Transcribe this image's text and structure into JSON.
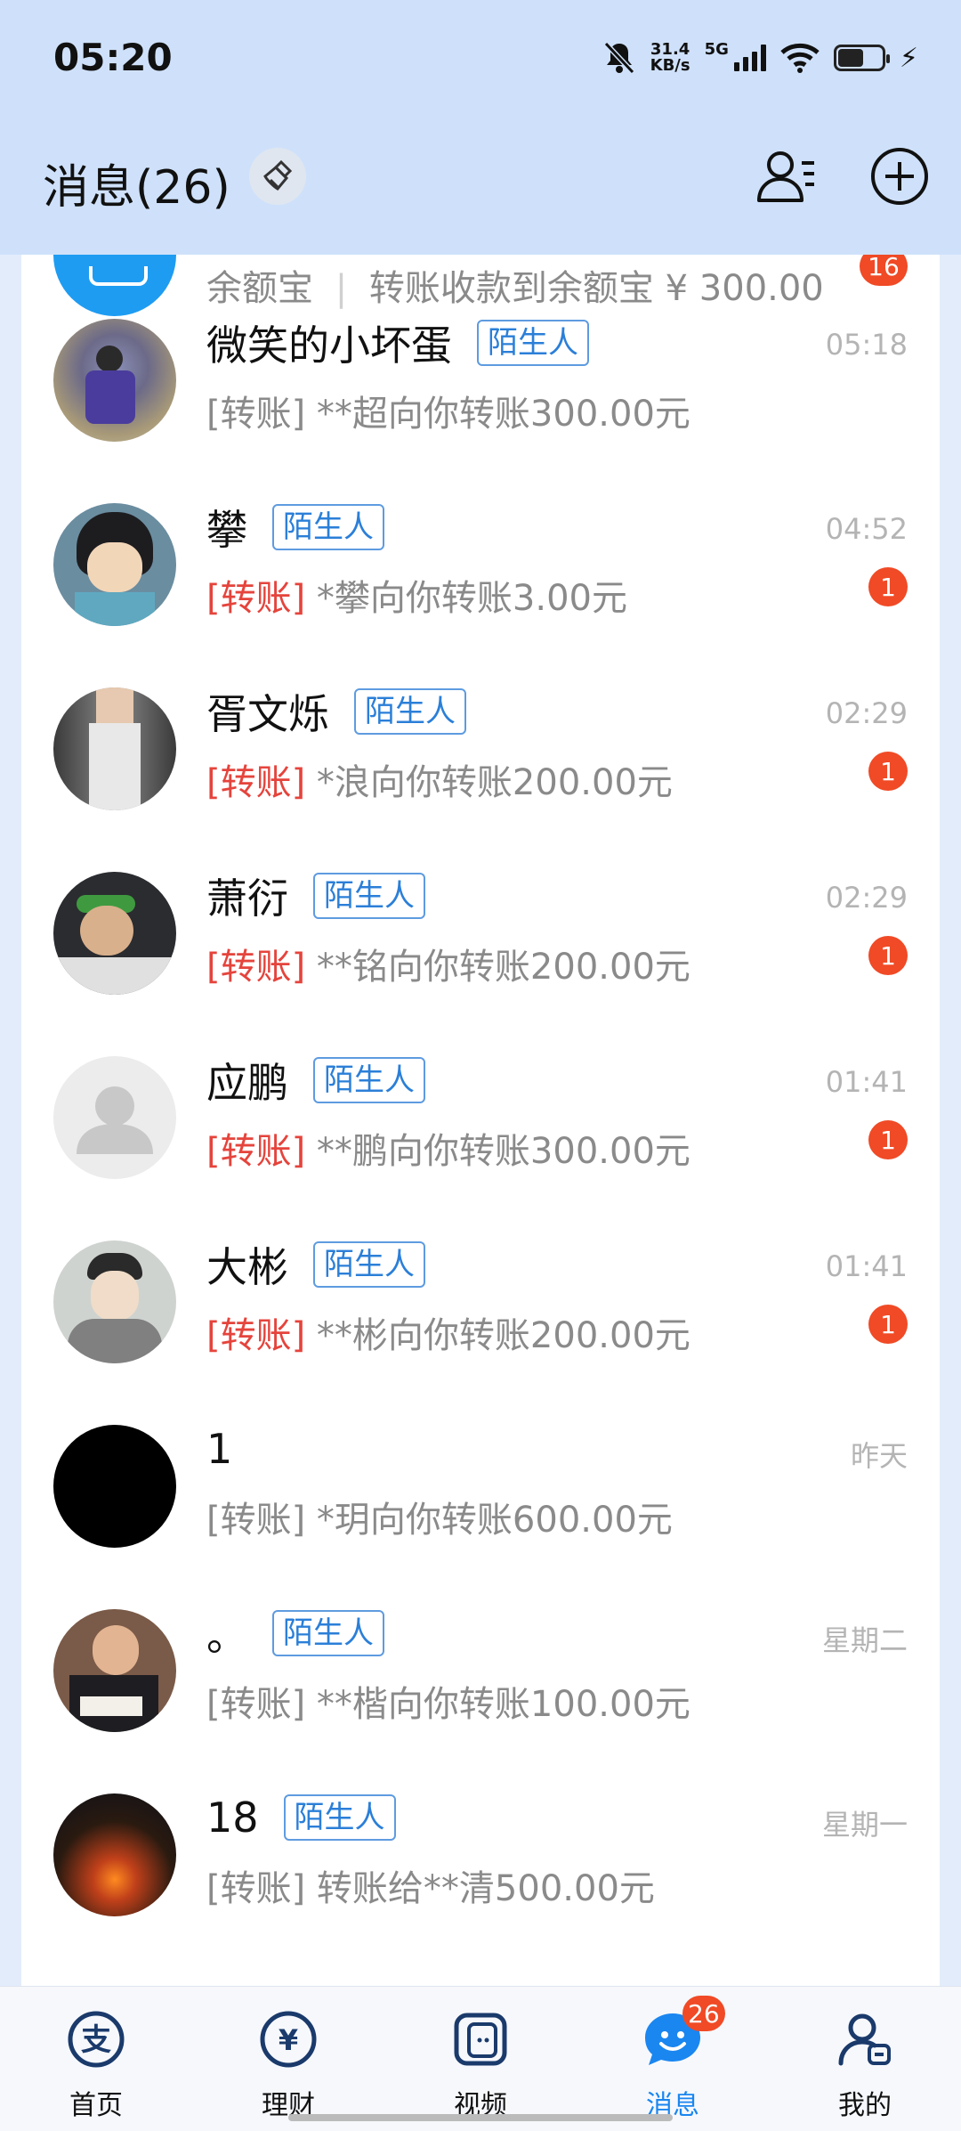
{
  "status": {
    "time": "05:20",
    "speed_top": "31.4",
    "speed_unit": "KB/s",
    "network": "5G"
  },
  "header": {
    "title": "消息(26)"
  },
  "partial_item": {
    "name": "余额宝",
    "message": "转账收款到余额宝 ¥ 300.00",
    "badge": "16"
  },
  "messages": [
    {
      "name": "微笑的小坏蛋",
      "tag": "陌生人",
      "time": "05:18",
      "prefix": "[转账]",
      "text": " **超向你转账300.00元",
      "unread": false,
      "badge": ""
    },
    {
      "name": "攀",
      "tag": "陌生人",
      "time": "04:52",
      "prefix": "[转账]",
      "text": " *攀向你转账3.00元",
      "unread": true,
      "badge": "1"
    },
    {
      "name": "胥文烁",
      "tag": "陌生人",
      "time": "02:29",
      "prefix": "[转账]",
      "text": " *浪向你转账200.00元",
      "unread": true,
      "badge": "1"
    },
    {
      "name": "萧衍",
      "tag": "陌生人",
      "time": "02:29",
      "prefix": "[转账]",
      "text": " **铭向你转账200.00元",
      "unread": true,
      "badge": "1"
    },
    {
      "name": "应鹏",
      "tag": "陌生人",
      "time": "01:41",
      "prefix": "[转账]",
      "text": " **鹏向你转账300.00元",
      "unread": true,
      "badge": "1"
    },
    {
      "name": "大彬",
      "tag": "陌生人",
      "time": "01:41",
      "prefix": "[转账]",
      "text": " **彬向你转账200.00元",
      "unread": true,
      "badge": "1"
    },
    {
      "name": "1",
      "tag": "",
      "time": "昨天",
      "prefix": "[转账]",
      "text": " *玥向你转账600.00元",
      "unread": false,
      "badge": ""
    },
    {
      "name": "。",
      "tag": "陌生人",
      "time": "星期二",
      "prefix": "[转账]",
      "text": " **楷向你转账100.00元",
      "unread": false,
      "badge": ""
    },
    {
      "name": "18",
      "tag": "陌生人",
      "time": "星期一",
      "prefix": "[转账]",
      "text": " 转账给**清500.00元",
      "unread": false,
      "badge": ""
    }
  ],
  "nav": {
    "home": "首页",
    "wealth": "理财",
    "video": "视频",
    "messages": "消息",
    "messages_badge": "26",
    "mine": "我的"
  },
  "colors": {
    "accent": "#1a86f0",
    "header_bg": "#cfe1fa",
    "badge": "#f04a26",
    "transfer_red": "#e5443c",
    "tag_blue": "#2b7fd8"
  }
}
